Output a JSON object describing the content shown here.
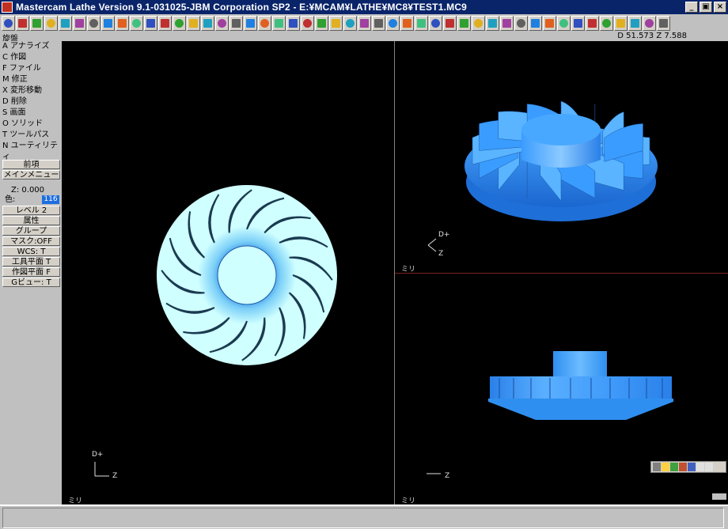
{
  "window": {
    "title": "Mastercam Lathe Version 9.1-031025-JBM Corporation SP2 - E:¥MCAM¥LATHE¥MC8¥TEST1.MC9",
    "minimize": "_",
    "maximize": "▣",
    "close": "×"
  },
  "toolbar": {
    "icons": [
      "arrow-left-icon",
      "arrow-right-icon",
      "c-hook-icon",
      "open-file-icon",
      "spline-icon",
      "wave-icon",
      "chamfer-icon",
      "surface-icon",
      "sphere-icon",
      "gear-icon",
      "cylinder-icon",
      "torus-icon",
      "star-icon",
      "disk-icon",
      "sew-icon",
      "no-icon",
      "rotate-icon",
      "tree-icon",
      "brand-icon",
      "knife-icon",
      "invert-icon",
      "rect-icon",
      "chart-icon",
      "region-icon",
      "cut-icon",
      "book-icon",
      "page-icon",
      "list-icon",
      "dim-icon",
      "bracket-icon",
      "point-icon",
      "flip-icon",
      "pulse-icon",
      "tangent-icon",
      "line-icon",
      "vertical-icon",
      "diag-icon",
      "arc-icon",
      "fillet-icon",
      "curl-icon",
      "ellipse-icon",
      "spread-icon",
      "h-dim-icon",
      "v-dim-icon",
      "slant-icon",
      "angle-icon",
      "help-icon"
    ]
  },
  "status": {
    "mode": "旋盤",
    "coords": "D 51.573   Z 7.588"
  },
  "menu": {
    "items": [
      "A アナライズ",
      "C 作図",
      "F ファイル",
      "M 修正",
      "X 変形移動",
      "D 削除",
      "S 画面",
      "O ソリッド",
      "T ツールパス",
      "N ユーティリティ"
    ],
    "prev": "前項",
    "main": "メインメニュー",
    "z": "Z:   0.000",
    "color_label": "色:",
    "color_value": "116",
    "level": "レベル 2",
    "attr": "属性",
    "group": "グループ",
    "mask": "マスク:OFF",
    "wcs": "WCS:   T",
    "tplane": "工具平面   T",
    "cplane": "作図平面   F",
    "gview": "Gビュー:   T"
  },
  "viewports": {
    "top_left_axis_d": "D+",
    "top_left_axis_z": "Z",
    "unit_label": "ミリ",
    "tr_axis_d": "D+",
    "tr_axis_z": "Z",
    "br_axis_z": "Z"
  },
  "colors": {
    "part_blue": "#2f8ff0",
    "part_face": "#cfffff",
    "viewport_bg": "#000000"
  }
}
